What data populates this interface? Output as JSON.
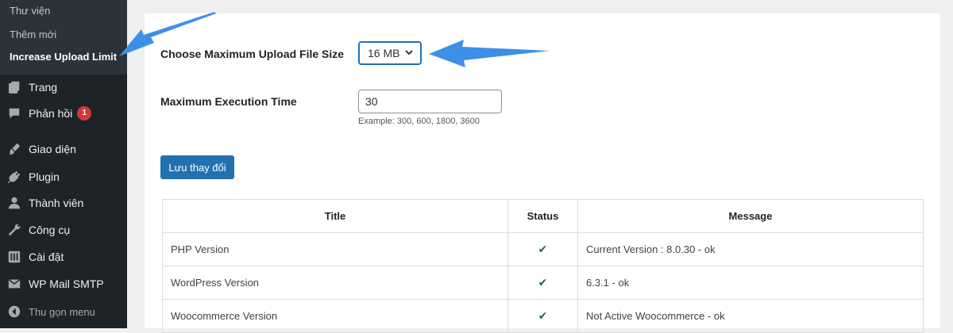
{
  "sidebar": {
    "submenu": [
      {
        "label": "Thư viện"
      },
      {
        "label": "Thêm mới"
      },
      {
        "label": "Increase Upload Limit"
      }
    ],
    "items": [
      {
        "label": "Trang",
        "icon": "pages-icon"
      },
      {
        "label": "Phản hồi",
        "icon": "comments-icon",
        "badge": "1"
      },
      {
        "label": "Giao diện",
        "icon": "appearance-icon"
      },
      {
        "label": "Plugin",
        "icon": "plugins-icon"
      },
      {
        "label": "Thành viên",
        "icon": "users-icon"
      },
      {
        "label": "Công cụ",
        "icon": "tools-icon"
      },
      {
        "label": "Cài đặt",
        "icon": "settings-icon"
      },
      {
        "label": "WP Mail SMTP",
        "icon": "mail-icon"
      },
      {
        "label": "Thu gọn menu",
        "icon": "collapse-icon"
      }
    ]
  },
  "form": {
    "upload_label": "Choose Maximum Upload File Size",
    "upload_value": "16 MB",
    "exec_label": "Maximum Execution Time",
    "exec_value": "30",
    "exec_help": "Example: 300, 600, 1800, 3600",
    "save_label": "Lưu thay đổi"
  },
  "table": {
    "headers": [
      "Title",
      "Status",
      "Message"
    ],
    "rows": [
      {
        "title": "PHP Version",
        "status": "✔",
        "message": "Current Version : 8.0.30 - ok"
      },
      {
        "title": "WordPress Version",
        "status": "✔",
        "message": "6.3.1 - ok"
      },
      {
        "title": "Woocommerce Version",
        "status": "✔",
        "message": "Not Active Woocommerce - ok"
      }
    ]
  },
  "colors": {
    "sidebar_bg": "#1d2327",
    "submenu_bg": "#2c3338",
    "accent": "#2271b1",
    "arrow": "#3d8fe8",
    "badge": "#d63638",
    "check": "#1e6d2e"
  }
}
